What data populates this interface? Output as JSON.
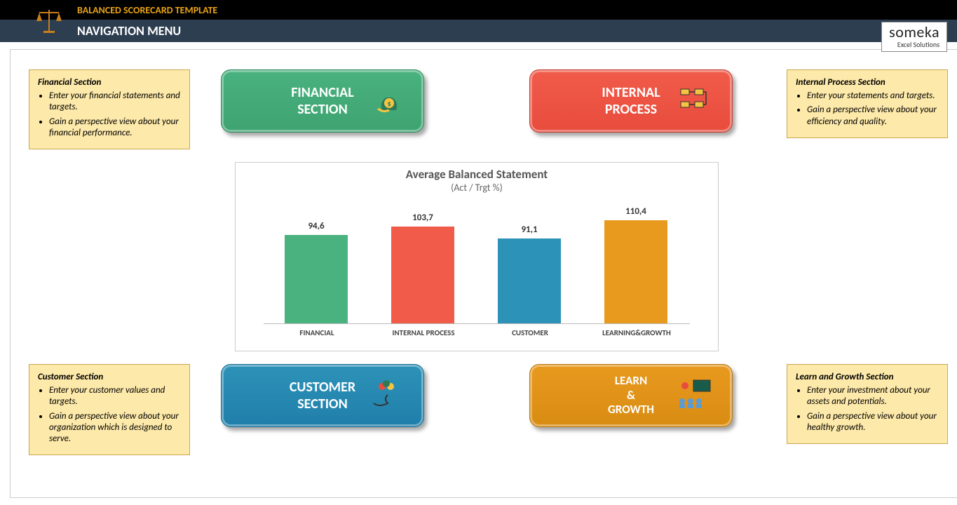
{
  "header": {
    "template": "BALANCED SCORECARD TEMPLATE",
    "nav": "NAVIGATION MENU"
  },
  "brand": {
    "name": "someka",
    "sub": "Excel Solutions"
  },
  "notes": {
    "fin": {
      "title": "Financial Section",
      "b1": "Enter your financial statements and targets.",
      "b2": "Gain a perspective view about your financial performance."
    },
    "int": {
      "title": "Internal Process Section",
      "b1": "Enter your statements and targets.",
      "b2": "Gain a perspective view about your efficiency and quality."
    },
    "cus": {
      "title": "Customer Section",
      "b1": "Enter your customer values and targets.",
      "b2": "Gain a perspective view about your organization which is designed to serve."
    },
    "lrn": {
      "title": "Learn and Growth Section",
      "b1": "Enter your investment about your assets and potentials.",
      "b2": "Gain a perspective view about your healthy growth."
    }
  },
  "buttons": {
    "fin": "FINANCIAL\nSECTION",
    "int": "INTERNAL\nPROCESS",
    "cus": "CUSTOMER\nSECTION",
    "lrn": "LEARN\n&\nGROWTH"
  },
  "chart_data": {
    "type": "bar",
    "title": "Average Balanced Statement",
    "subtitle": "(Act / Trgt %)",
    "categories": [
      "FINANCIAL",
      "INTERNAL PROCESS",
      "CUSTOMER",
      "LEARNING&GROWTH"
    ],
    "values": [
      94.6,
      103.7,
      91.1,
      110.4
    ],
    "value_labels": [
      "94,6",
      "103,7",
      "91,1",
      "110,4"
    ],
    "colors": [
      "#49b27e",
      "#f15b4a",
      "#2d92b8",
      "#e89a1f"
    ],
    "ylim": [
      0,
      120
    ]
  }
}
